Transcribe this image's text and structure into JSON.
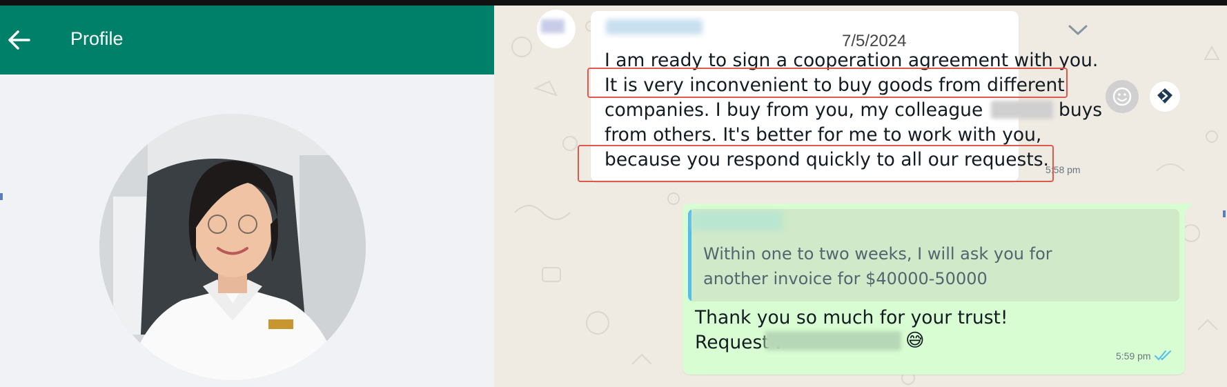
{
  "profile": {
    "title": "Profile"
  },
  "chat": {
    "date": "7/5/2024",
    "incoming": {
      "lines": [
        "I am ready to sign a cooperation agreement with you.",
        "It is very inconvenient to buy goods from different",
        "companies. I buy from you, my colleague",
        "buys",
        "from others. It's better for me to work with you,",
        "because you respond quickly to all our requests."
      ],
      "time": "5:58 pm"
    },
    "outgoing": {
      "quote_lines": [
        "Within one to two weeks, I will ask you for",
        "another invoice for $40000-50000"
      ],
      "lines": [
        "Thank you so much for your trust!",
        "Request :"
      ],
      "emoji": "😅",
      "time": "5:59 pm",
      "status": "read"
    }
  },
  "colors": {
    "header": "#008069",
    "chat_bg": "#efeae2",
    "outgoing_bubble": "#d9fdd3",
    "quote_bar": "#53bdeb",
    "highlight": "#e2574c",
    "read_ticks": "#53bdeb"
  },
  "icons": [
    "back-arrow-icon",
    "chevron-down-icon",
    "emoji-icon",
    "forward-icon",
    "double-check-icon"
  ]
}
